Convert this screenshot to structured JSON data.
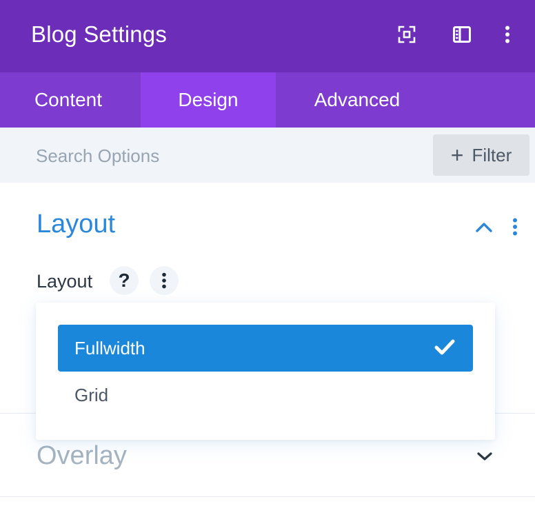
{
  "header": {
    "title": "Blog Settings",
    "icons": [
      "fullscreen-icon",
      "sidebar-layout-icon",
      "more-vertical-icon"
    ],
    "background": "#6c2eb9"
  },
  "tabs": [
    {
      "label": "Content",
      "active": false
    },
    {
      "label": "Design",
      "active": true
    },
    {
      "label": "Advanced",
      "active": false
    }
  ],
  "search": {
    "placeholder": "Search Options",
    "value": "",
    "filter_label": "Filter",
    "filter_icon": "plus-icon"
  },
  "sections": {
    "layout": {
      "title": "Layout",
      "expanded": true,
      "field": {
        "label": "Layout",
        "help_symbol": "?",
        "options": [
          {
            "label": "Fullwidth",
            "selected": true
          },
          {
            "label": "Grid",
            "selected": false
          }
        ]
      }
    },
    "overlay": {
      "title": "Overlay",
      "expanded": false
    }
  },
  "colors": {
    "accent": "#2b87da",
    "selected_option": "#1a87da",
    "tab_bar": "#7e3bd0",
    "active_tab": "#8f42ec"
  }
}
